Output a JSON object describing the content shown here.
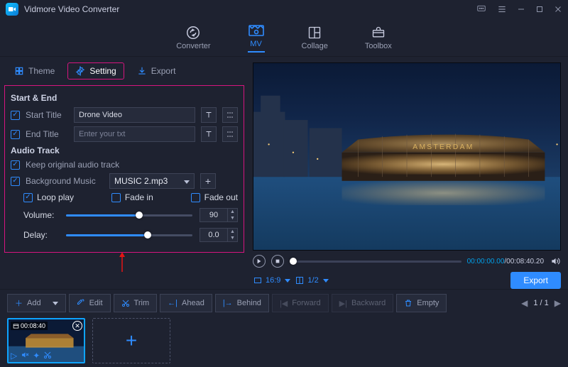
{
  "app": {
    "title": "Vidmore Video Converter"
  },
  "nav": {
    "converter": "Converter",
    "mv": "MV",
    "collage": "Collage",
    "toolbox": "Toolbox"
  },
  "tabs": {
    "theme": "Theme",
    "setting": "Setting",
    "export": "Export"
  },
  "settings": {
    "startend_header": "Start & End",
    "start_title_label": "Start Title",
    "start_title_value": "Drone Video",
    "end_title_label": "End Title",
    "end_title_placeholder": "Enter your txt",
    "audio_header": "Audio Track",
    "keep_original_label": "Keep original audio track",
    "bg_music_label": "Background Music",
    "bg_music_value": "MUSIC 2.mp3",
    "loop_label": "Loop play",
    "fadein_label": "Fade in",
    "fadeout_label": "Fade out",
    "volume_label": "Volume:",
    "volume_value": "90",
    "delay_label": "Delay:",
    "delay_value": "0.0"
  },
  "player": {
    "current_time": "00:00:00.00",
    "total_time": "00:08:40.20",
    "aspect": "16:9",
    "pages": "1/2"
  },
  "export": {
    "label": "Export"
  },
  "toolbar": {
    "add": "Add",
    "edit": "Edit",
    "trim": "Trim",
    "ahead": "Ahead",
    "behind": "Behind",
    "forward": "Forward",
    "backward": "Backward",
    "empty": "Empty"
  },
  "pager": {
    "current": "1",
    "total": "1"
  },
  "thumb": {
    "duration": "00:08:40"
  }
}
